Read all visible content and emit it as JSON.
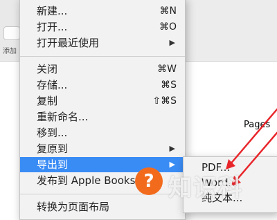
{
  "background": {
    "toolbar_label": "添加",
    "document_text": "Pages"
  },
  "file_menu": {
    "items": [
      {
        "label": "新建...",
        "shortcut": "⌘N"
      },
      {
        "label": "打开...",
        "shortcut": "⌘O"
      },
      {
        "label": "打开最近使用",
        "arrow": "▶"
      },
      {
        "label": "关闭",
        "shortcut": "⌘W"
      },
      {
        "label": "存储...",
        "shortcut": "⌘S"
      },
      {
        "label": "复制",
        "shortcut": "⇧⌘S"
      },
      {
        "label": "重新命名..."
      },
      {
        "label": "移到..."
      },
      {
        "label": "复原到",
        "arrow": "▶"
      },
      {
        "label": "导出到",
        "arrow": "▶",
        "highlighted": true
      },
      {
        "label": "发布到 Apple Books..."
      },
      {
        "label": "转换为页面布局"
      }
    ]
  },
  "export_submenu": {
    "items": [
      {
        "label": "PDF..."
      },
      {
        "label": "Word..."
      },
      {
        "label": "纯文本..."
      }
    ]
  },
  "watermark": {
    "icon_char": "?",
    "text": "知识科"
  },
  "colors": {
    "highlight": "#3a8cf5",
    "annotation": "#e8252a",
    "watermark_circle": "#f26b1d"
  }
}
